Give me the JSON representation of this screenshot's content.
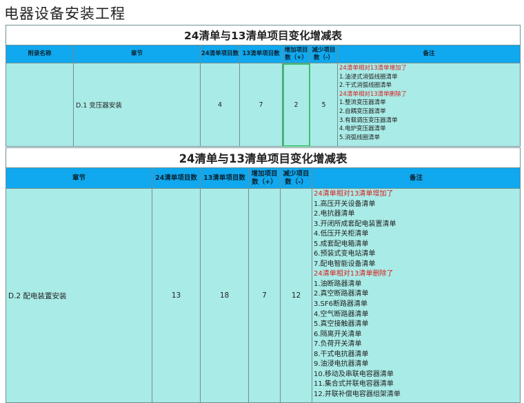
{
  "page_title": "电器设备安装工程",
  "table1": {
    "caption": "24清单与13清单项目变化增减表",
    "headers": [
      "附录名称",
      "章节",
      "24清单项目数",
      "13清单项目数",
      "增加项目数（+）",
      "减少项目数（-）",
      "备注"
    ],
    "row": {
      "appendix": "",
      "chapter": "D.1  变压器安装",
      "count24": "4",
      "count13": "7",
      "added": "2",
      "removed": "5",
      "notes": [
        {
          "text": "24清单相对13清单增加了",
          "red": true
        },
        {
          "text": "1.油浸式消弧线圈清单",
          "red": false
        },
        {
          "text": "2.干式消弧线圈清单",
          "red": false
        },
        {
          "text": "24清单相对13清单删除了",
          "red": true
        },
        {
          "text": "1.整流变压器清单",
          "red": false
        },
        {
          "text": "2.自耦变压器清单",
          "red": false
        },
        {
          "text": "3.有载调压变压器清单",
          "red": false
        },
        {
          "text": "4.电炉变压器清单",
          "red": false
        },
        {
          "text": "5.消弧线圈清单",
          "red": false
        }
      ]
    }
  },
  "table2": {
    "caption": "24清单与13清单项目变化增减表",
    "headers": [
      "章节",
      "24清单项目数",
      "13清单项目数",
      "增加项目数（+）",
      "减少项目数（-）",
      "备注"
    ],
    "row": {
      "chapter": "D.2  配电装置安装",
      "count24": "13",
      "count13": "18",
      "added": "7",
      "removed": "12",
      "notes": [
        {
          "text": "24清单相对13清单增加了",
          "red": true
        },
        {
          "text": "1.高压开关设备清单",
          "red": false
        },
        {
          "text": "2.电抗器清单",
          "red": false
        },
        {
          "text": "3.开闭所成套配电装置清单",
          "red": false
        },
        {
          "text": "4.低压开关柜清单",
          "red": false
        },
        {
          "text": "5.成套配电箱清单",
          "red": false
        },
        {
          "text": "6.预装式变电站清单",
          "red": false
        },
        {
          "text": "7.配电智能设备清单",
          "red": false
        },
        {
          "text": "24清单相对13清单删除了",
          "red": true
        },
        {
          "text": "1.油断路器清单",
          "red": false
        },
        {
          "text": "2.真空断路器清单",
          "red": false
        },
        {
          "text": "3.SF6断路器清单",
          "red": false
        },
        {
          "text": "4.空气断路器清单",
          "red": false
        },
        {
          "text": "5.真空接触器清单",
          "red": false
        },
        {
          "text": "6.隔离开关清单",
          "red": false
        },
        {
          "text": "7.负荷开关清单",
          "red": false
        },
        {
          "text": "8.干式电抗器清单",
          "red": false
        },
        {
          "text": "9.油浸电抗器清单",
          "red": false
        },
        {
          "text": "10.移动及串联电容器清单",
          "red": false
        },
        {
          "text": "11.集合式并联电容器清单",
          "red": false
        },
        {
          "text": "12.并联补偿电容器组架清单",
          "red": false
        }
      ]
    }
  },
  "colors": {
    "header_bg": "#10a8ee",
    "body_bg": "#a9ebe6",
    "note_red": "#d91e1e",
    "highlight_border": "#3bbf6f"
  }
}
